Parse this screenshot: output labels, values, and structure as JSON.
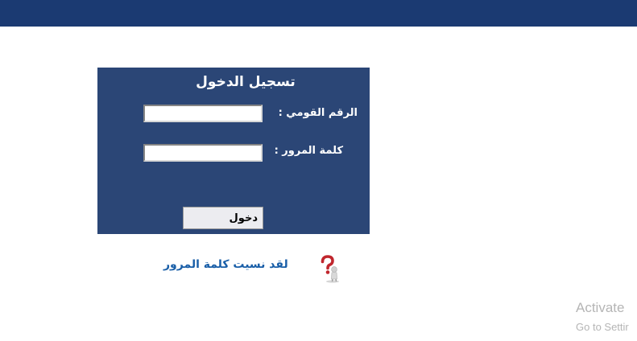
{
  "login": {
    "title": "تسجيل الدخول",
    "national_id_label": "الرقم القومي :",
    "national_id_value": "",
    "password_label": "كلمة المرور :",
    "password_value": "",
    "submit_label": "دخول"
  },
  "forgot_password": {
    "link_text": "لقد نسيت كلمة المرور",
    "icon": "help-question-icon"
  },
  "windows_watermark": {
    "title": "Activate",
    "subtitle": "Go to Settir"
  },
  "colors": {
    "top_bar": "#1b3a72",
    "panel": "#2b4676",
    "link": "#1a5fa8",
    "icon_accent": "#c0262d"
  }
}
